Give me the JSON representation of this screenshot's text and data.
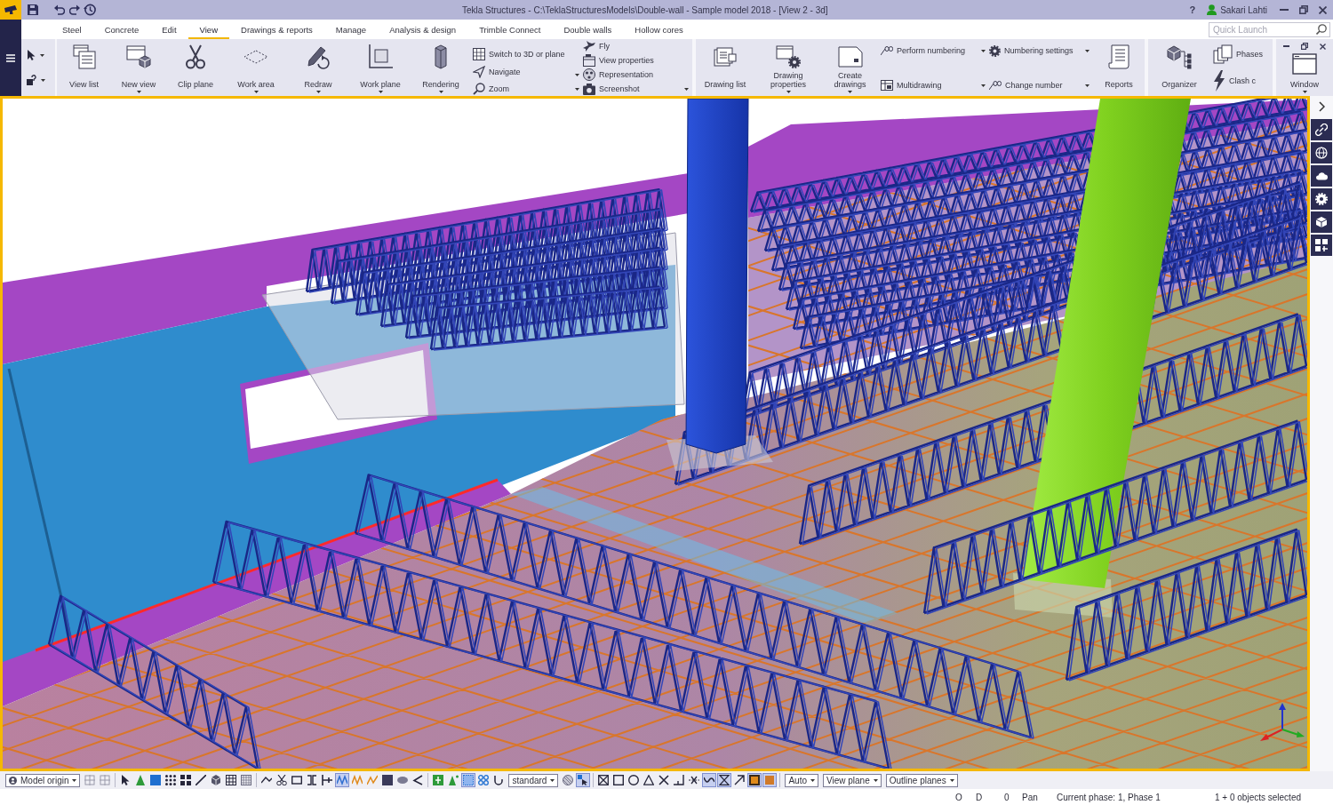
{
  "title_bar": {
    "title": "Tekla Structures - C:\\TeklaStructuresModels\\Double-wall - Sample model 2018 - [View 2 - 3d]",
    "help": "?",
    "user": "Sakari Lahti"
  },
  "tabs": [
    {
      "label": "Steel",
      "selected": false
    },
    {
      "label": "Concrete",
      "selected": false
    },
    {
      "label": "Edit",
      "selected": false
    },
    {
      "label": "View",
      "selected": true
    },
    {
      "label": "Drawings & reports",
      "selected": false
    },
    {
      "label": "Manage",
      "selected": false
    },
    {
      "label": "Analysis & design",
      "selected": false
    },
    {
      "label": "Trimble Connect",
      "selected": false
    },
    {
      "label": "Double walls",
      "selected": false
    },
    {
      "label": "Hollow cores",
      "selected": false
    }
  ],
  "quick_launch": {
    "placeholder": "Quick Launch"
  },
  "ribbon": [
    {
      "items": [
        {
          "kind": "large",
          "label": "View list",
          "dropdown": false
        },
        {
          "kind": "large",
          "label": "New view",
          "dropdown": true
        },
        {
          "kind": "large",
          "label": "Clip plane",
          "dropdown": false
        },
        {
          "kind": "large",
          "label": "Work area",
          "dropdown": true
        },
        {
          "kind": "large",
          "label": "Redraw",
          "dropdown": true
        },
        {
          "kind": "large",
          "label": "Work plane",
          "dropdown": true
        },
        {
          "kind": "large",
          "label": "Rendering",
          "dropdown": true
        },
        {
          "kind": "stack",
          "items": [
            {
              "label": "Switch to 3D or plane",
              "dropdown": false,
              "split": false
            },
            {
              "label": "Navigate",
              "dropdown": false,
              "split": false
            },
            {
              "label": "Zoom",
              "dropdown": false,
              "split": false
            }
          ]
        },
        {
          "kind": "stack",
          "items": [
            {
              "label": "Fly",
              "dropdown": false,
              "split": false
            },
            {
              "label": "View properties",
              "dropdown": false,
              "split": false
            },
            {
              "label": "Representation",
              "dropdown": true,
              "split": false
            },
            {
              "label": "Screenshot",
              "dropdown": true,
              "split": true
            }
          ]
        }
      ]
    },
    {
      "items": [
        {
          "kind": "large",
          "label": "Drawing list",
          "dropdown": false
        },
        {
          "kind": "large",
          "label": "Drawing properties",
          "dropdown": true
        },
        {
          "kind": "large",
          "label": "Create drawings",
          "dropdown": true
        },
        {
          "kind": "stack",
          "items": [
            {
              "label": "Perform numbering",
              "dropdown": false,
              "split": false
            },
            {
              "label": "Multidrawing",
              "dropdown": false,
              "split": false
            }
          ]
        },
        {
          "kind": "stack",
          "items": [
            {
              "label": "Numbering settings",
              "dropdown": true,
              "split": true
            },
            {
              "label": "Change number",
              "dropdown": true,
              "split": true
            }
          ]
        },
        {
          "kind": "large",
          "label": "Reports",
          "dropdown": false
        }
      ]
    },
    {
      "items": [
        {
          "kind": "large",
          "label": "Organizer",
          "dropdown": false
        },
        {
          "kind": "stack",
          "items": [
            {
              "label": "Phases",
              "dropdown": false,
              "split": false
            },
            {
              "label": "Clash c",
              "dropdown": false,
              "split": false
            }
          ]
        }
      ]
    },
    {
      "items": [
        {
          "kind": "large",
          "label": "Window",
          "dropdown": true
        }
      ]
    }
  ],
  "bottom_toolbar": {
    "groups": [
      {
        "items": [
          {
            "kind": "dropdown",
            "value": "Model origin"
          },
          {
            "kind": "button",
            "on": false
          },
          {
            "kind": "button",
            "on": false
          }
        ]
      },
      {
        "items": [
          {
            "kind": "button",
            "on": false
          },
          {
            "kind": "button",
            "on": false
          },
          {
            "kind": "button",
            "on": false
          },
          {
            "kind": "button",
            "on": false
          },
          {
            "kind": "button",
            "on": false
          },
          {
            "kind": "button",
            "on": false
          },
          {
            "kind": "button",
            "on": false
          },
          {
            "kind": "button",
            "on": false
          },
          {
            "kind": "button",
            "on": false
          }
        ]
      },
      {
        "items": [
          {
            "kind": "button",
            "on": false
          },
          {
            "kind": "button",
            "on": false
          },
          {
            "kind": "button",
            "on": false
          },
          {
            "kind": "button",
            "on": false
          },
          {
            "kind": "button",
            "on": false
          },
          {
            "kind": "button",
            "on": true
          },
          {
            "kind": "button",
            "on": false
          },
          {
            "kind": "button",
            "on": false
          },
          {
            "kind": "button",
            "on": false
          },
          {
            "kind": "button",
            "on": false
          },
          {
            "kind": "button",
            "on": false
          }
        ]
      },
      {
        "items": [
          {
            "kind": "button",
            "on": false
          },
          {
            "kind": "button",
            "on": false
          },
          {
            "kind": "button",
            "on": true
          },
          {
            "kind": "button",
            "on": false
          },
          {
            "kind": "button",
            "on": false
          },
          {
            "kind": "dropdown",
            "value": "standard"
          },
          {
            "kind": "button",
            "on": false
          },
          {
            "kind": "button",
            "on": true
          }
        ]
      },
      {
        "items": [
          {
            "kind": "button",
            "on": false
          },
          {
            "kind": "button",
            "on": false
          },
          {
            "kind": "button",
            "on": false
          },
          {
            "kind": "button",
            "on": false
          },
          {
            "kind": "button",
            "on": false
          },
          {
            "kind": "button",
            "on": false
          },
          {
            "kind": "button",
            "on": false
          },
          {
            "kind": "button",
            "on": true
          },
          {
            "kind": "button",
            "on": true
          },
          {
            "kind": "button",
            "on": false
          },
          {
            "kind": "button",
            "on": true
          },
          {
            "kind": "button",
            "on": true
          }
        ]
      },
      {
        "items": [
          {
            "kind": "dropdown",
            "value": "Auto"
          },
          {
            "kind": "dropdown",
            "value": "View plane"
          },
          {
            "kind": "dropdown",
            "value": "Outline planes"
          }
        ]
      }
    ]
  },
  "status_bar": {
    "fields": [
      "O",
      "D",
      "0",
      "Pan",
      "Current phase: 1, Phase 1",
      "1 + 0 objects selected"
    ]
  }
}
